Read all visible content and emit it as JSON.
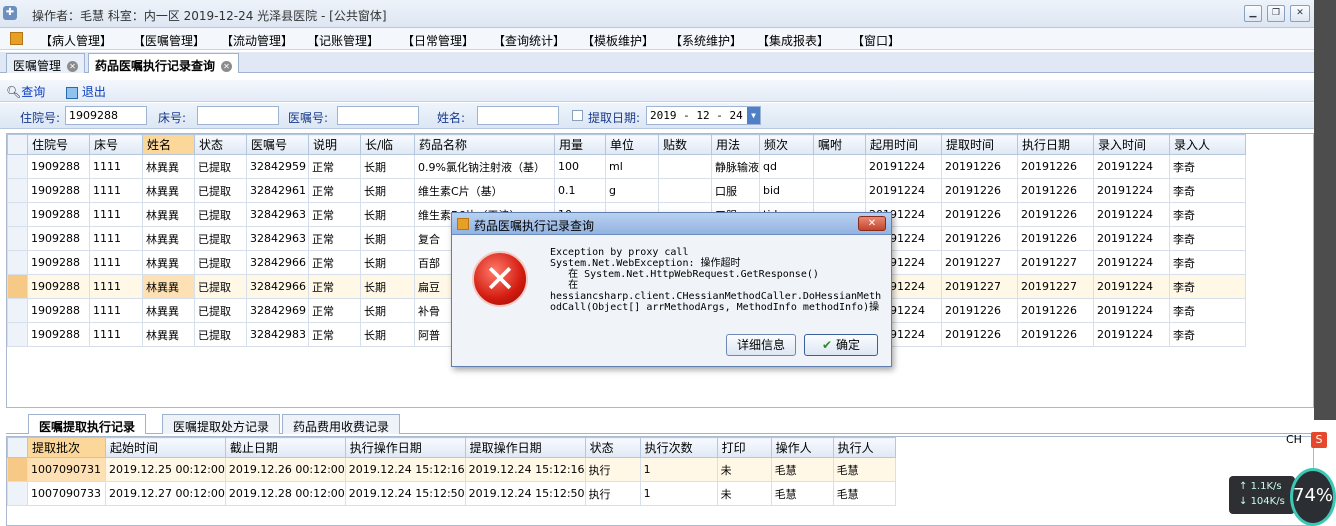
{
  "window": {
    "title": "操作者：毛慧 科室：内一区 2019-12-24 光泽县医院 - [公共窗体]"
  },
  "menu": [
    "【病人管理】",
    "【医嘱管理】",
    "【流动管理】",
    "【记账管理】",
    "【日常管理】",
    "【查询统计】",
    "【模板维护】",
    "【系统维护】",
    "【集成报表】",
    "【窗口】"
  ],
  "tabs": [
    "医嘱管理",
    "药品医嘱执行记录查询"
  ],
  "toolbar": {
    "query": "查询",
    "exit": "退出"
  },
  "filter": {
    "zyh_label": "住院号:",
    "zyh_value": "1909288",
    "bed_label": "床号:",
    "yzh_label": "医嘱号:",
    "name_label": "姓名:",
    "date_label": "提取日期:",
    "date_value": "2019 - 12 - 24"
  },
  "main_table": {
    "columns": [
      "住院号",
      "床号",
      "姓名",
      "状态",
      "医嘱号",
      "说明",
      "长/临",
      "药品名称",
      "用量",
      "单位",
      "贴数",
      "用法",
      "频次",
      "嘱咐",
      "起用时间",
      "提取时间",
      "执行日期",
      "录入时间",
      "录入人"
    ],
    "rows": [
      [
        "1909288",
        "1111",
        "林異異",
        "已提取",
        "32842959",
        "正常",
        "长期",
        "0.9%氯化钠注射液（基）",
        "100",
        "ml",
        "",
        "静脉输液",
        "qd",
        "",
        "20191224",
        "20191226",
        "20191226",
        "20191224",
        "李奇"
      ],
      [
        "1909288",
        "1111",
        "林異異",
        "已提取",
        "32842961",
        "正常",
        "长期",
        "维生素C片（基）",
        "0.1",
        "g",
        "",
        "口服",
        "bid",
        "",
        "20191224",
        "20191226",
        "20191226",
        "20191224",
        "李奇"
      ],
      [
        "1909288",
        "1111",
        "林異異",
        "已提取",
        "32842963",
        "正常",
        "长期",
        "维生素B6片（天津）",
        "10",
        "mg",
        "",
        "口服",
        "tid",
        "",
        "20191224",
        "20191226",
        "20191226",
        "20191224",
        "李奇"
      ],
      [
        "1909288",
        "1111",
        "林異異",
        "已提取",
        "32842963",
        "正常",
        "长期",
        "复合",
        "",
        "",
        "",
        "",
        "",
        "",
        "20191224",
        "20191226",
        "20191226",
        "20191224",
        "李奇"
      ],
      [
        "1909288",
        "1111",
        "林異異",
        "已提取",
        "32842966",
        "正常",
        "长期",
        "百部",
        "",
        "",
        "",
        "",
        "",
        "",
        "20191224",
        "20191227",
        "20191227",
        "20191224",
        "李奇"
      ],
      [
        "1909288",
        "1111",
        "林異異",
        "已提取",
        "32842966",
        "正常",
        "长期",
        "扁豆",
        "",
        "",
        "",
        "",
        "",
        "",
        "20191224",
        "20191227",
        "20191227",
        "20191224",
        "李奇"
      ],
      [
        "1909288",
        "1111",
        "林異異",
        "已提取",
        "32842969",
        "正常",
        "长期",
        "补骨",
        "",
        "",
        "",
        "",
        "",
        "",
        "20191224",
        "20191226",
        "20191226",
        "20191224",
        "李奇"
      ],
      [
        "1909288",
        "1111",
        "林異異",
        "已提取",
        "32842983",
        "正常",
        "长期",
        "阿普",
        "",
        "",
        "",
        "",
        "",
        "",
        "20191224",
        "20191226",
        "20191226",
        "20191224",
        "李奇"
      ]
    ]
  },
  "bottom_tabs": [
    "医嘱提取执行记录",
    "医嘱提取处方记录",
    "药品费用收费记录"
  ],
  "bottom_table": {
    "columns": [
      "提取批次",
      "起始时间",
      "截止日期",
      "执行操作日期",
      "提取操作日期",
      "状态",
      "执行次数",
      "打印",
      "操作人",
      "执行人"
    ],
    "rows": [
      [
        "1007090731",
        "2019.12.25 00:12:00",
        "2019.12.26 00:12:00",
        "2019.12.24 15:12:16",
        "2019.12.24 15:12:16",
        "执行",
        "1",
        "未",
        "毛慧",
        "毛慧"
      ],
      [
        "1007090733",
        "2019.12.27 00:12:00",
        "2019.12.28 00:12:00",
        "2019.12.24 15:12:50",
        "2019.12.24 15:12:50",
        "执行",
        "1",
        "未",
        "毛慧",
        "毛慧"
      ]
    ]
  },
  "dialog": {
    "title": "药品医嘱执行记录查询",
    "message": "Exception by proxy call\nSystem.Net.WebException: 操作超时\n   在 System.Net.HttpWebRequest.GetResponse()\n   在\nhessiancsharp.client.CHessianMethodCaller.DoHessianMethodCall(Object[] arrMethodArgs, MethodInfo methodInfo)操",
    "detail_button": "详细信息",
    "ok_button": "确定"
  },
  "tray": {
    "ime": "CH",
    "up": "1.1K/s",
    "down": "104K/s",
    "percent": "74%"
  }
}
